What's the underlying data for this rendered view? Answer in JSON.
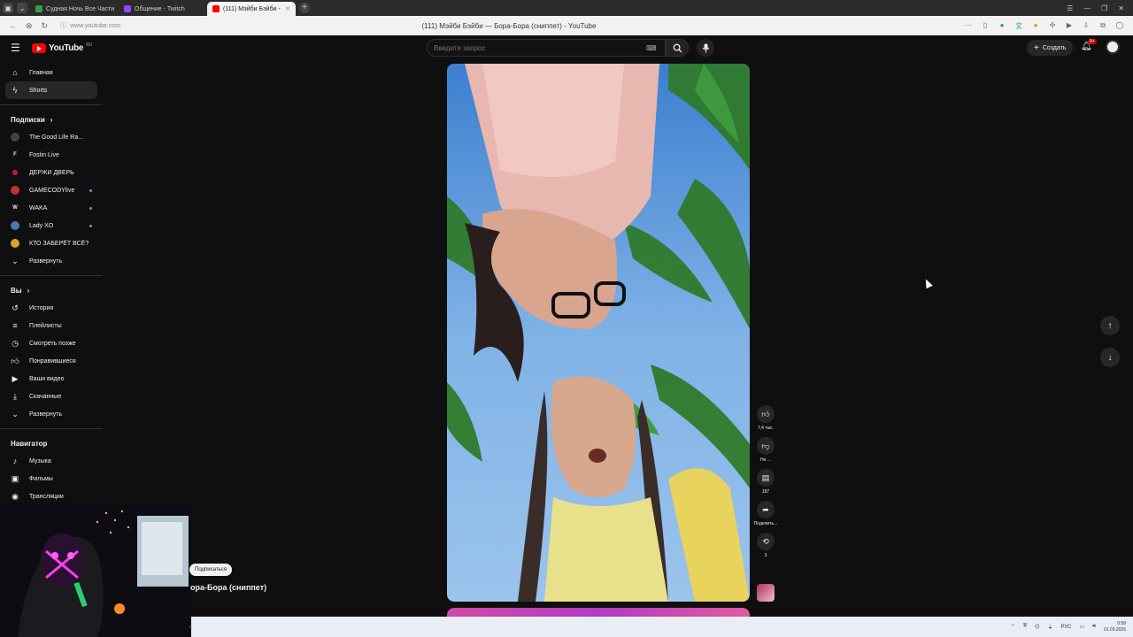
{
  "browser": {
    "tabs": [
      {
        "label": "Судная Ночь Все Части",
        "color": "#2e9e4a"
      },
      {
        "label": "Общение - Twitch",
        "color": "#9146ff"
      },
      {
        "label": "(111) Мэйби Бэйби -",
        "color": "#ff0000"
      }
    ],
    "url": "www.youtube.com",
    "page_title": "(111) Мэйби Бэйби — Бора-Бора (сниппет) - YouTube"
  },
  "header": {
    "logo_text": "YouTube",
    "logo_country": "RU",
    "search_placeholder": "Введите запрос",
    "create_label": "Создать",
    "notifications_badge": "9+"
  },
  "sidebar": {
    "main": [
      {
        "label": "Главная",
        "icon": "home-icon"
      },
      {
        "label": "Shorts",
        "icon": "shorts-icon",
        "active": true
      }
    ],
    "subscriptions_title": "Подписки",
    "subscriptions": [
      {
        "label": "The Good Life Ra...",
        "color": "#444"
      },
      {
        "label": "Fostin Live",
        "color": "#111",
        "letter": "F"
      },
      {
        "label": "ДЕРЖИ ДВЕРЬ",
        "color": "#c0202a"
      },
      {
        "label": "GAMECODYlive",
        "color": "#b33"
      },
      {
        "label": "WAKA",
        "color": "#111",
        "letter": "W"
      },
      {
        "label": "Lady XO",
        "color": "#4a78b0"
      },
      {
        "label": "КТО ЗАБЕРЁТ ВСЁ?",
        "color": "#d7a520"
      }
    ],
    "subscriptions_expand": "Развернуть",
    "you_title": "Вы",
    "you": [
      {
        "label": "История",
        "icon": "history-icon"
      },
      {
        "label": "Плейлисты",
        "icon": "playlists-icon"
      },
      {
        "label": "Смотреть позже",
        "icon": "clock-icon"
      },
      {
        "label": "Понравившиеся",
        "icon": "thumbs-up-icon"
      },
      {
        "label": "Ваши видео",
        "icon": "your-videos-icon"
      },
      {
        "label": "Скачанные",
        "icon": "download-icon"
      }
    ],
    "you_expand": "Развернуть",
    "navigator_title": "Навигатор",
    "navigator": [
      {
        "label": "Музыка",
        "icon": "music-icon"
      },
      {
        "label": "Фильмы",
        "icon": "film-icon"
      },
      {
        "label": "Трансляции",
        "icon": "live-icon"
      }
    ]
  },
  "short": {
    "likes": "7,4 тыс.",
    "dislike_label": "Не ...",
    "comments": "187",
    "share_label": "Поделить...",
    "remix_count": "3",
    "subscribe_label": "Подписаться",
    "title": "ора-Бора (сниппет)"
  },
  "taskbar": {
    "lang": "РУС",
    "time": "0:58",
    "date": "01.03.2026"
  }
}
